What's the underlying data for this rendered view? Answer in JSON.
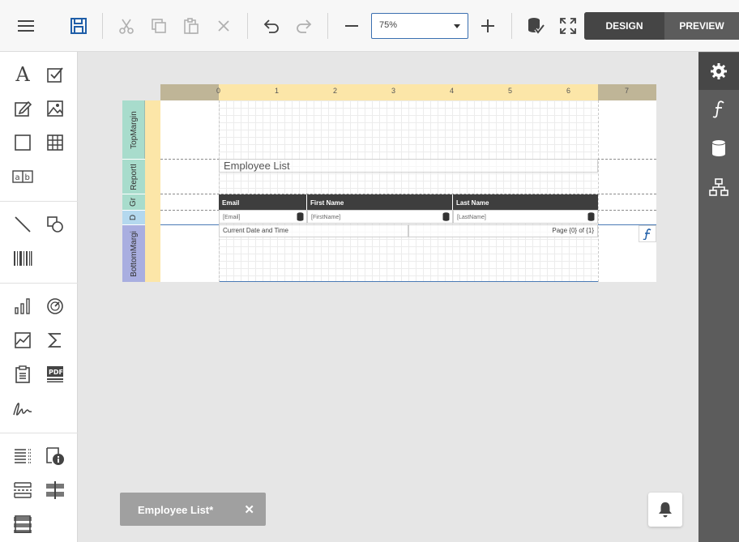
{
  "toolbar": {
    "zoom_value": "75%",
    "design_label": "DESIGN",
    "preview_label": "PREVIEW"
  },
  "toolbox": {
    "text_glyph": "A",
    "label_glyph": "ab"
  },
  "report": {
    "ruler_numbers": [
      "0",
      "1",
      "2",
      "3",
      "4",
      "5",
      "6",
      "7"
    ],
    "bands": [
      "TopMargin",
      "ReportI",
      "Gr",
      "D",
      "BottomMargi"
    ],
    "title": "Employee List",
    "headers": [
      "Email",
      "First Name",
      "Last Name"
    ],
    "fields": [
      "[Email]",
      "[FirstName]",
      "[LastName]"
    ],
    "footer_left": "Current Date and Time",
    "footer_right": "Page {0} of {1}"
  },
  "doc_tab": {
    "label": "Employee List*",
    "close": "✕"
  },
  "colors": {
    "band_top": "#a8dccc",
    "band_bottom": "#a9aee0",
    "accent_blue": "#1f5ea8",
    "ruler_light": "#fce6a8"
  }
}
